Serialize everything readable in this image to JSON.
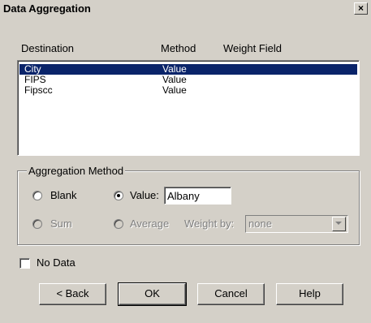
{
  "window": {
    "title": "Data Aggregation",
    "close_label": "×"
  },
  "columns": {
    "destination": "Destination",
    "method": "Method",
    "weight_field": "Weight Field"
  },
  "rows": [
    {
      "destination": "City",
      "method": "Value",
      "weight_field": "",
      "selected": true
    },
    {
      "destination": "FIPS",
      "method": "Value",
      "weight_field": "",
      "selected": false
    },
    {
      "destination": "Fipscc",
      "method": "Value",
      "weight_field": "",
      "selected": false
    }
  ],
  "aggregation": {
    "group_label": "Aggregation Method",
    "blank_label": "Blank",
    "value_label": "Value:",
    "value_input": "Albany",
    "sum_label": "Sum",
    "average_label": "Average",
    "weight_by_label": "Weight by:",
    "weight_by_value": "none",
    "selected": "value"
  },
  "no_data": {
    "label": "No Data",
    "checked": false
  },
  "buttons": {
    "back": "< Back",
    "ok": "OK",
    "cancel": "Cancel",
    "help": "Help"
  },
  "colors": {
    "face": "#d4d0c8",
    "selection": "#0a246a",
    "disabled_text": "#808080"
  }
}
